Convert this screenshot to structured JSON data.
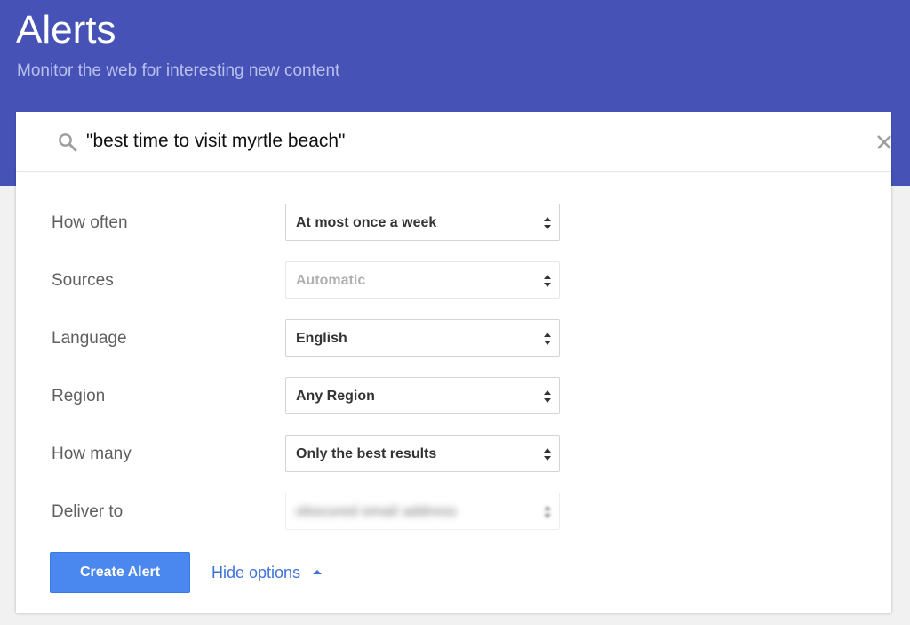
{
  "header": {
    "title": "Alerts",
    "subtitle": "Monitor the web for interesting new content",
    "background_color": "#4652b6"
  },
  "search": {
    "value": "\"best time to visit myrtle beach\"",
    "icon": "search-icon",
    "clear_icon": "close-icon"
  },
  "options": [
    {
      "label": "How often",
      "value": "At most once a week",
      "state": "normal"
    },
    {
      "label": "Sources",
      "value": "Automatic",
      "state": "disabled"
    },
    {
      "label": "Language",
      "value": "English",
      "state": "normal"
    },
    {
      "label": "Region",
      "value": "Any Region",
      "state": "normal"
    },
    {
      "label": "How many",
      "value": "Only the best results",
      "state": "normal"
    },
    {
      "label": "Deliver to",
      "value": "obscured email address",
      "state": "blurred"
    }
  ],
  "actions": {
    "create_label": "Create Alert",
    "hide_options_label": "Hide options",
    "button_color": "#4a87ee",
    "link_color": "#3e72d8"
  }
}
